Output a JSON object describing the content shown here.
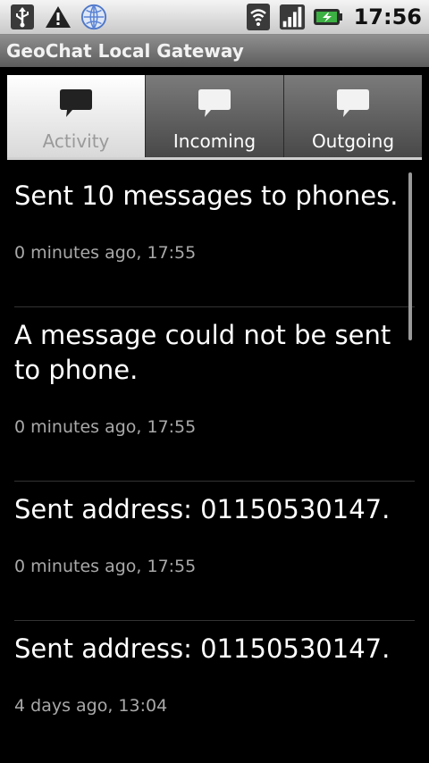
{
  "status_bar": {
    "time": "17:56",
    "left_icons": [
      "usb-icon",
      "warning-icon",
      "globe-app-icon"
    ],
    "right_icons": [
      "wifi-icon",
      "signal-icon",
      "battery-charging-icon"
    ]
  },
  "app": {
    "title": "GeoChat Local Gateway"
  },
  "tabs": [
    {
      "label": "Activity",
      "icon": "speech-bubble-icon",
      "active": true
    },
    {
      "label": "Incoming",
      "icon": "speech-bubble-icon",
      "active": false
    },
    {
      "label": "Outgoing",
      "icon": "speech-bubble-icon",
      "active": false
    }
  ],
  "activity_log": [
    {
      "message": "Sent 10 messages to phones.",
      "time": "0 minutes ago, 17:55"
    },
    {
      "message": "A message could not be sent to phone.",
      "time": "0 minutes ago, 17:55"
    },
    {
      "message": "Sent address: 01150530147.",
      "time": "0 minutes ago, 17:55"
    },
    {
      "message": "Sent address: 01150530147.",
      "time": "4 days ago, 13:04"
    }
  ],
  "colors": {
    "background": "#000000",
    "meta_text": "#a9a9a9",
    "active_tab": "#ffffff",
    "inactive_tab": "#6a6a6a"
  }
}
